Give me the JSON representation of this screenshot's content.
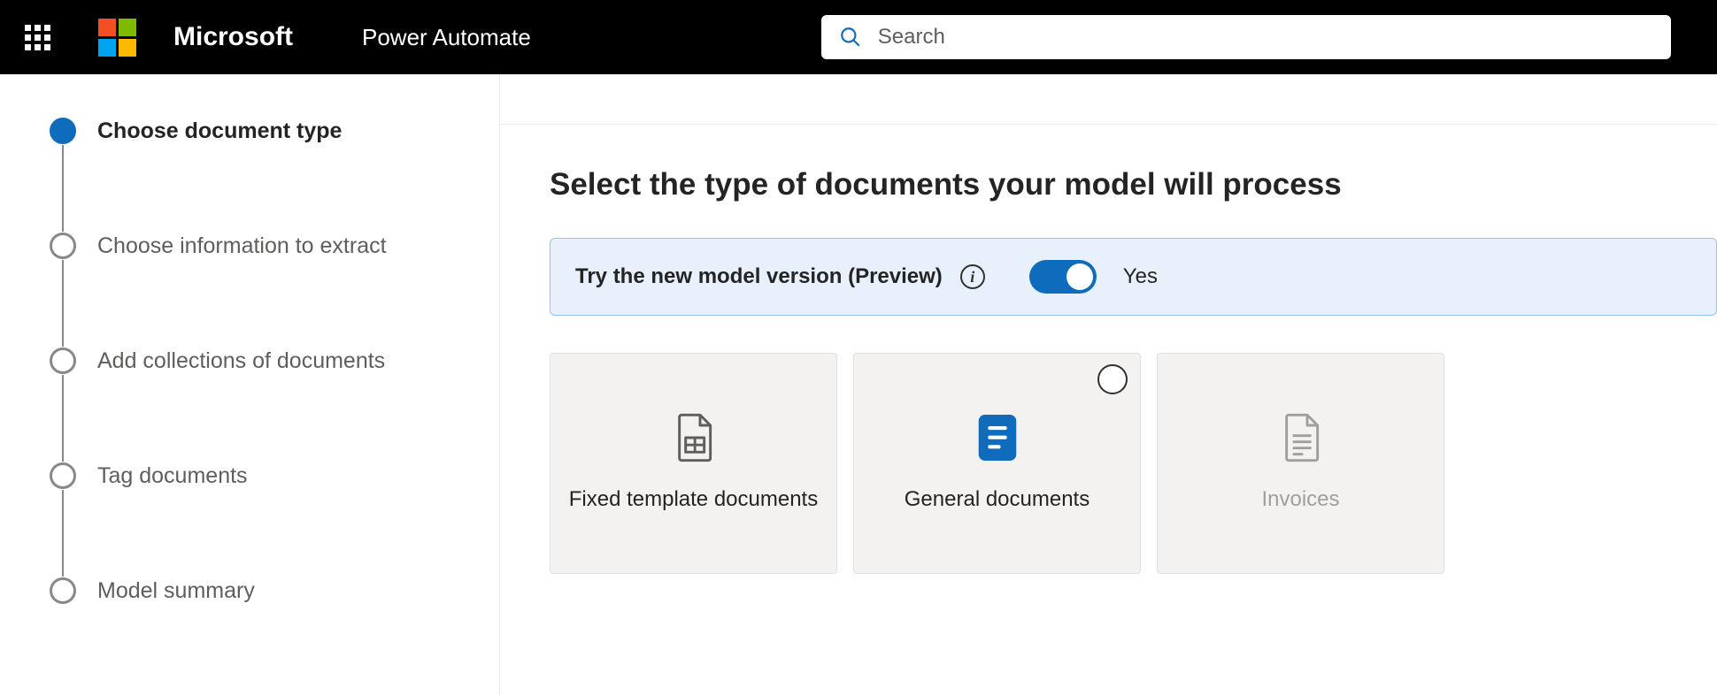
{
  "header": {
    "brand": "Microsoft",
    "app": "Power Automate",
    "search_placeholder": "Search"
  },
  "sidebar": {
    "steps": [
      {
        "label": "Choose document type",
        "active": true
      },
      {
        "label": "Choose information to extract",
        "active": false
      },
      {
        "label": "Add collections of documents",
        "active": false
      },
      {
        "label": "Tag documents",
        "active": false
      },
      {
        "label": "Model summary",
        "active": false
      }
    ]
  },
  "main": {
    "title": "Select the type of documents your model will process",
    "preview": {
      "text": "Try the new model version (Preview)",
      "toggle_on": true,
      "toggle_label": "Yes"
    },
    "cards": [
      {
        "label": "Fixed template documents",
        "icon": "file-template",
        "selected": false,
        "show_radio": false,
        "disabled": false
      },
      {
        "label": "General documents",
        "icon": "file-general",
        "selected": false,
        "show_radio": true,
        "disabled": false
      },
      {
        "label": "Invoices",
        "icon": "file-invoice",
        "selected": false,
        "show_radio": false,
        "disabled": true
      }
    ]
  }
}
